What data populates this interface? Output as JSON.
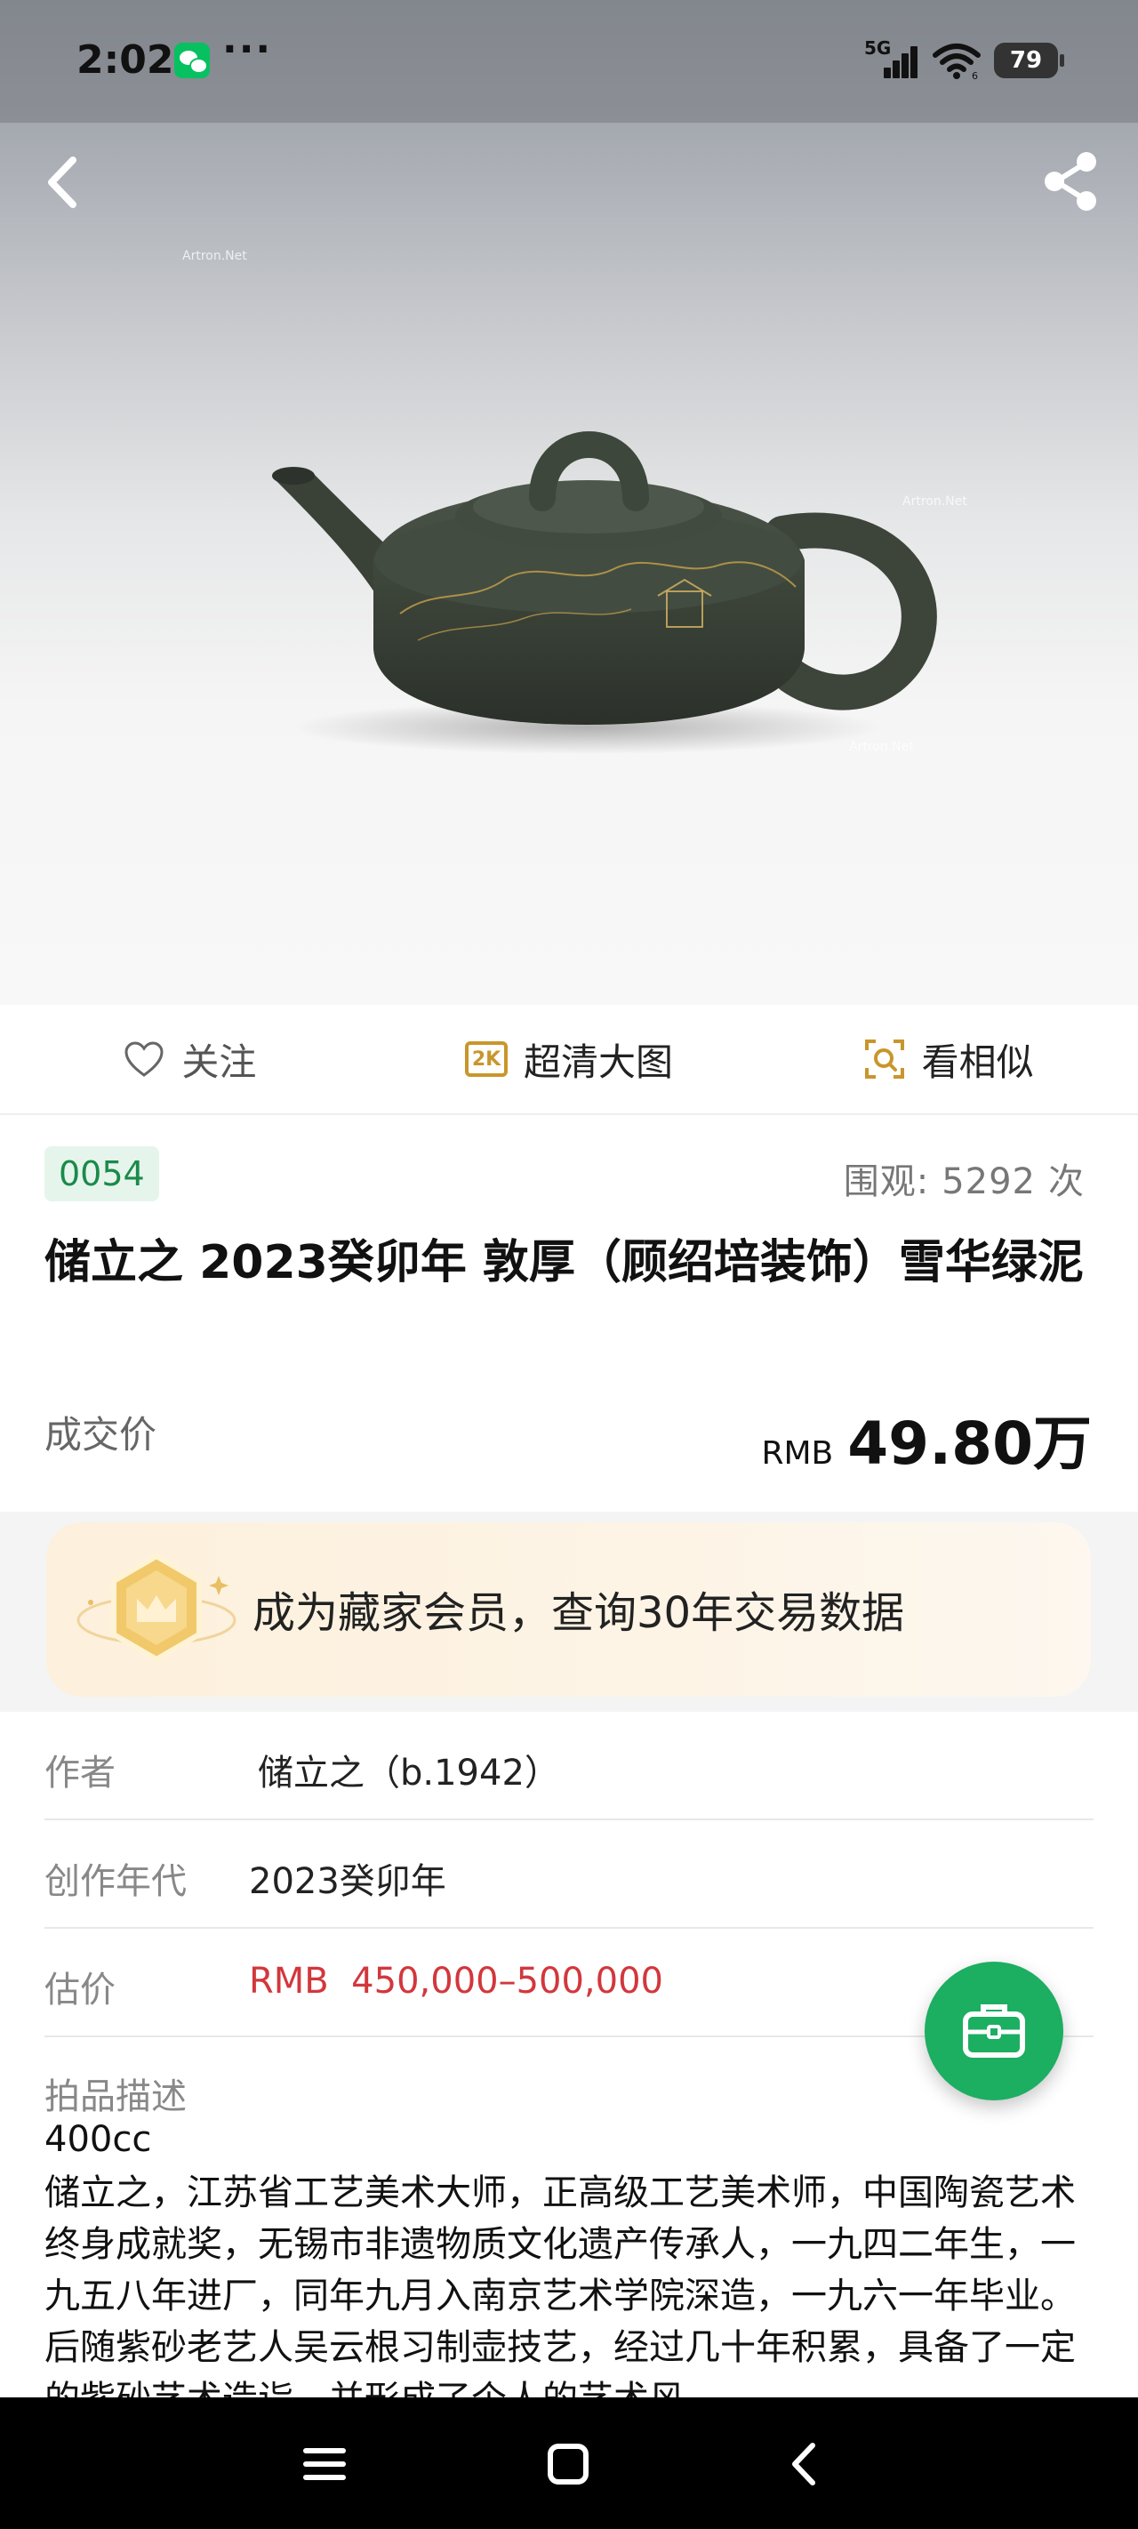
{
  "status_bar": {
    "time": "2:02",
    "more": "···",
    "network": "5G",
    "wifi_badge": "6",
    "battery": "79"
  },
  "icons": {
    "back": "chevron-left-icon",
    "share": "share-icon",
    "follow": "heart-icon",
    "hd": "2k-icon",
    "similar": "scan-icon",
    "fab": "briefcase-icon"
  },
  "hero": {
    "watermark": "Artron.Net"
  },
  "actions": {
    "follow_label": "关注",
    "hd_badge": "2K",
    "hd_label": "超清大图",
    "similar_label": "看相似"
  },
  "lot": {
    "number": "0054",
    "views_label": "围观:",
    "views_count": "5292",
    "views_unit": "次",
    "title": "储立之 2023癸卯年 敦厚（顾绍培装饰）雪华绿泥",
    "deal_label": "成交价",
    "price_currency": "RMB",
    "price_value": "49.80万"
  },
  "member_banner": {
    "text": "成为藏家会员，查询30年交易数据"
  },
  "details": {
    "rows": [
      {
        "key": "作者",
        "value": "储立之（b.1942）"
      },
      {
        "key": "创作年代",
        "value": "2023癸卯年"
      },
      {
        "key": "估价",
        "value": "RMB  450,000–500,000"
      }
    ],
    "desc_label": "拍品描述",
    "desc_size": "400cc",
    "desc_text": "储立之，江苏省工艺美术大师，正高级工艺美术师，中国陶瓷艺术终身成就奖，无锡市非遗物质文化遗产传承人，一九四二年生，一九五八年进厂，同年九月入南京艺术学院深造，一九六一年毕业。后随紫砂老艺人吴云根习制壶技艺，经过几十年积累，具备了一定的紫砂艺术造诣，并形成了个人的艺术风"
  },
  "colors": {
    "accent_green": "#1cae61",
    "lot_green": "#1a8a4a",
    "estimate_red": "#d2373c",
    "gold": "#c9962c"
  }
}
